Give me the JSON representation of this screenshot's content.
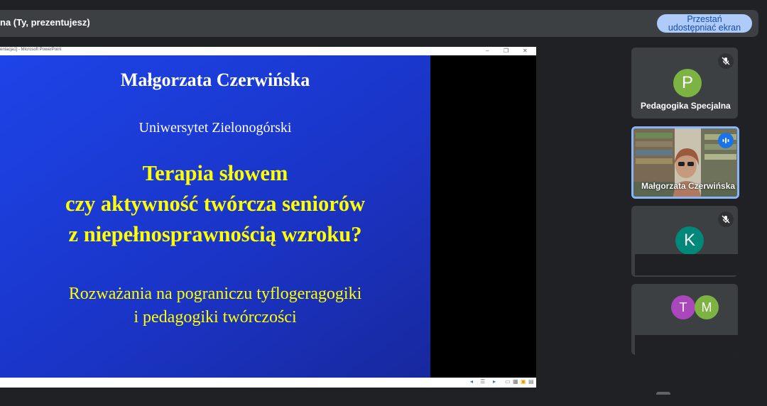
{
  "topbar": {
    "presenter_label": "na (Ty, prezentujesz)",
    "stop_share_line1": "Przestań",
    "stop_share_line2": "udostępniać ekran"
  },
  "share": {
    "window_title": "entacja1] - Microsoft PowerPoint",
    "win_min": "–",
    "win_max": "❐",
    "win_close": "✕",
    "slide": {
      "author": "Małgorzata Czerwińska",
      "university": "Uniwersytet Zielonogórski",
      "title_line1": "Terapia słowem",
      "title_line2": "czy aktywność twórcza seniorów",
      "title_line3": "z niepełnosprawnością wzroku?",
      "subtitle_line1": "Rozważania na pograniczu tyflogeragogiki",
      "subtitle_line2": "i pedagogiki twórczości"
    }
  },
  "participants": [
    {
      "name": "Pedagogika Specjalna",
      "initial": "P",
      "color": "#7cb342"
    },
    {
      "name": "Małgorzata Czerwińska",
      "speaking": true,
      "accent": "#8ab4f8"
    },
    {
      "initial": "K",
      "color": "#00897b"
    },
    {
      "initials": [
        "T",
        "M"
      ],
      "colors": [
        "#ab47bc",
        "#7cb342"
      ]
    }
  ],
  "icons": {
    "mic_off": "mic-off-icon",
    "speaking": "audio-level-icon",
    "slideshow": "slideshow-icon"
  }
}
